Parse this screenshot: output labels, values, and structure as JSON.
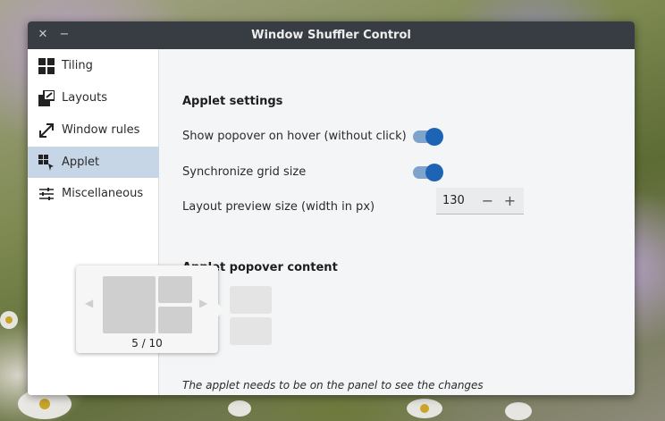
{
  "window": {
    "title": "Window Shuffler Control"
  },
  "titlebar": {
    "close_glyph": "✕",
    "minimize_glyph": "−"
  },
  "sidebar": {
    "items": [
      {
        "label": "Tiling",
        "icon": "tiling-icon"
      },
      {
        "label": "Layouts",
        "icon": "layouts-icon"
      },
      {
        "label": "Window rules",
        "icon": "window-rules-icon"
      },
      {
        "label": "Applet",
        "icon": "applet-icon",
        "active": true
      },
      {
        "label": "Miscellaneous",
        "icon": "sliders-icon"
      }
    ]
  },
  "applet_settings": {
    "title": "Applet settings",
    "show_popover": {
      "label": "Show popover on hover (without click)",
      "on": true
    },
    "sync_grid": {
      "label": "Synchronize grid size",
      "on": true
    },
    "preview_size": {
      "label": "Layout preview size (width in px)",
      "value": "130",
      "minus": "−",
      "plus": "+"
    }
  },
  "popover_content": {
    "title": "Applet popover content",
    "note": "The applet needs to be on the panel to see the changes"
  },
  "popover": {
    "counter": "5 / 10",
    "prev_glyph": "◀",
    "next_glyph": "▶"
  },
  "colors": {
    "accent": "#1e64b4",
    "active_sidebar": "#c6d6e6",
    "titlebar": "#383d43"
  }
}
